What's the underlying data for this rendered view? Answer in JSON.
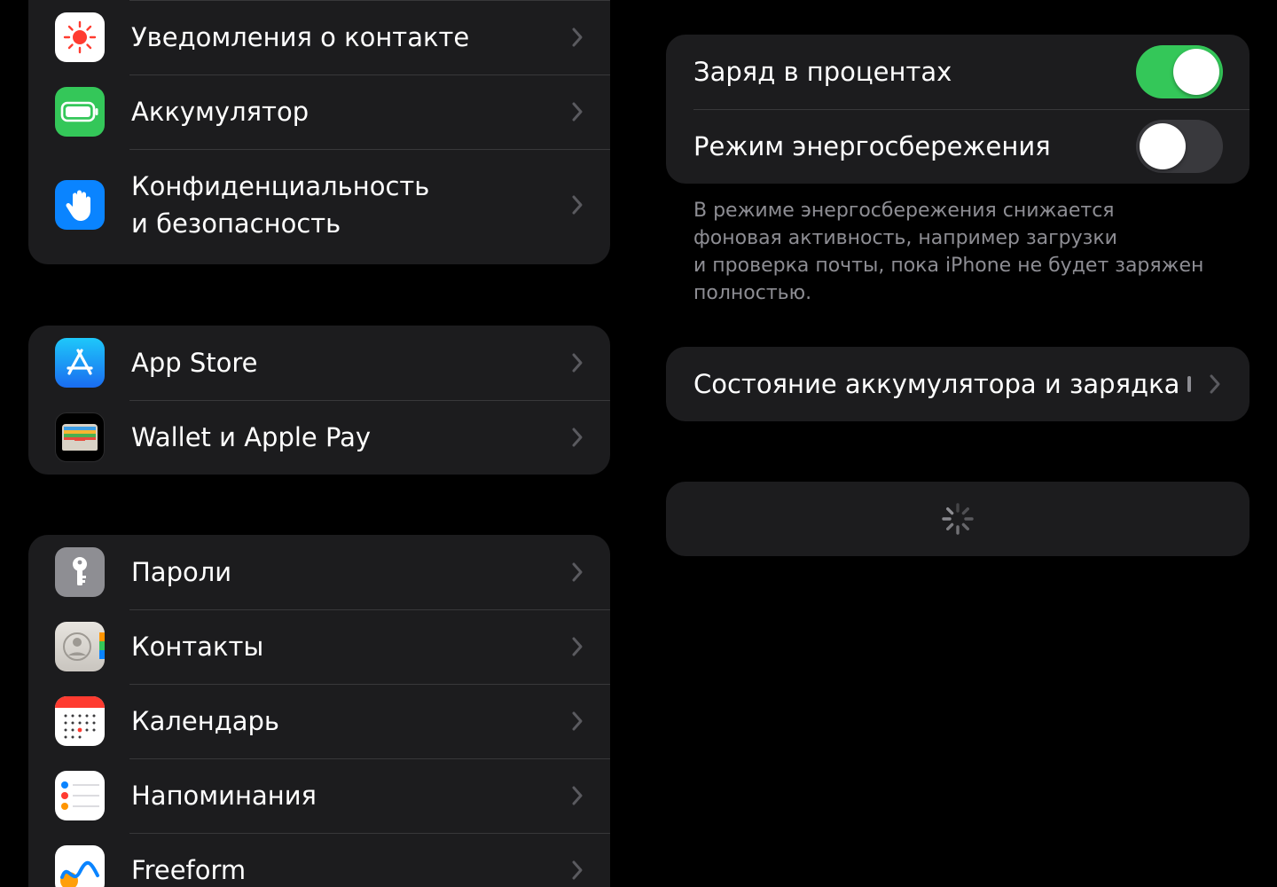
{
  "colors": {
    "background": "#000000",
    "group_background": "#1c1c1e",
    "separator": "#38383a",
    "toggle_on": "#34c759",
    "toggle_off": "#39393d",
    "secondary_text": "#8d8d93",
    "chevron": "#5a5a5f"
  },
  "left": {
    "group1": [
      {
        "label": "Уведомления о контакте",
        "icon": "exposure-notification-icon"
      },
      {
        "label": "Аккумулятор",
        "icon": "battery-icon"
      },
      {
        "label": "Конфиденциальность\nи безопасность",
        "icon": "privacy-hand-icon"
      }
    ],
    "group2": [
      {
        "label": "App Store",
        "icon": "app-store-icon"
      },
      {
        "label": "Wallet и Apple Pay",
        "icon": "wallet-icon"
      }
    ],
    "group3": [
      {
        "label": "Пароли",
        "icon": "key-icon"
      },
      {
        "label": "Контакты",
        "icon": "contacts-icon"
      },
      {
        "label": "Календарь",
        "icon": "calendar-icon"
      },
      {
        "label": "Напоминания",
        "icon": "reminders-icon"
      },
      {
        "label": "Freeform",
        "icon": "freeform-icon"
      }
    ]
  },
  "right": {
    "battery_percentage": {
      "label": "Заряд в процентах",
      "enabled": true
    },
    "low_power_mode": {
      "label": "Режим энергосбережения",
      "enabled": false
    },
    "footnote": "В режиме энергосбережения снижается\nфоновая активность, например загрузки\nи проверка почты, пока iPhone не будет заряжен\nполностью.",
    "battery_health": {
      "label": "Состояние аккумулятора и зарядка"
    },
    "loading": {
      "icon": "activity-spinner-icon"
    }
  }
}
